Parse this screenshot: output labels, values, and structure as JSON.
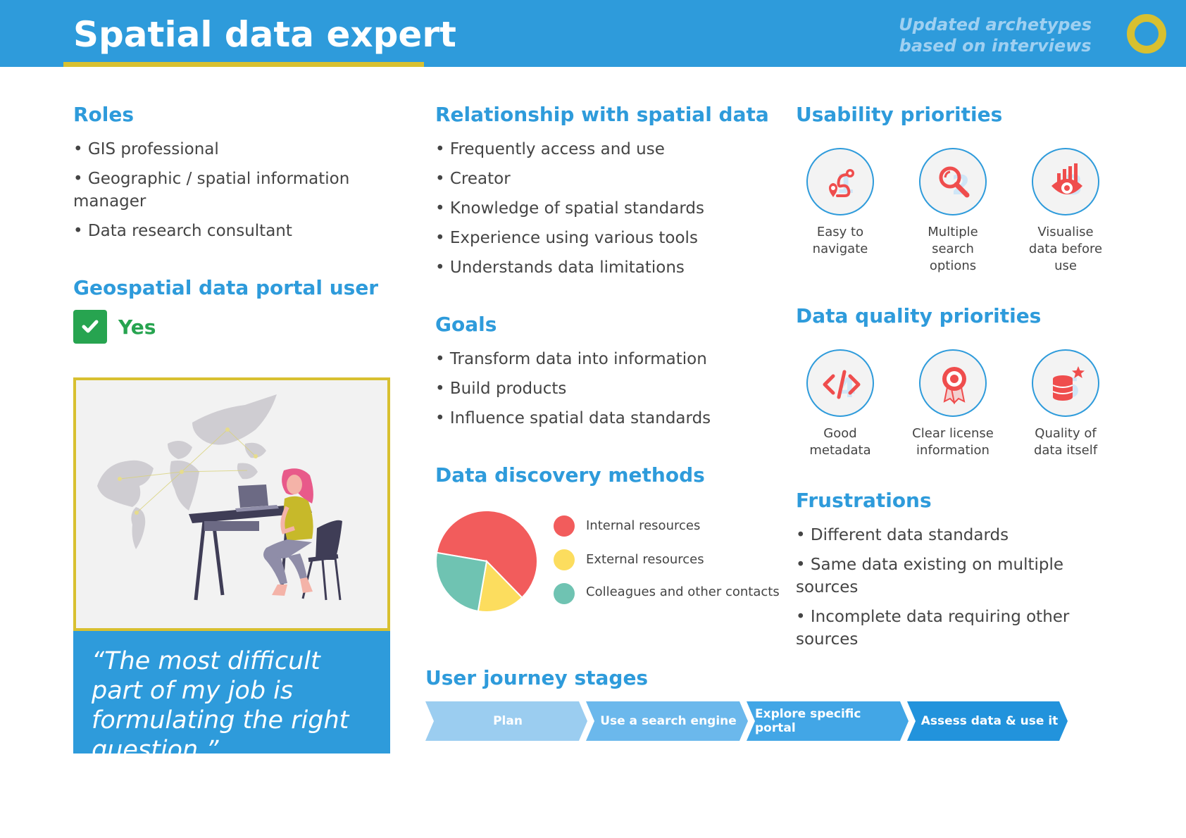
{
  "header": {
    "title": "Spatial data expert",
    "note_line1": "Updated archetypes",
    "note_line2": "based on interviews"
  },
  "roles": {
    "heading": "Roles",
    "items": [
      "GIS professional",
      "Geographic / spatial information manager",
      "Data research consultant"
    ]
  },
  "portal_user": {
    "heading": "Geospatial data portal user",
    "value": "Yes"
  },
  "quote": "“The most difficult part of my job is formulating the right question.”",
  "relationship": {
    "heading": "Relationship with spatial data",
    "items": [
      "Frequently access and use",
      "Creator",
      "Knowledge of spatial standards",
      "Experience using various tools",
      "Understands data limitations"
    ]
  },
  "goals": {
    "heading": "Goals",
    "items": [
      "Transform data into information",
      "Build products",
      "Influence spatial data standards"
    ]
  },
  "discovery": {
    "heading": "Data discovery methods"
  },
  "chart_data": {
    "type": "pie",
    "categories": [
      "Internal resources",
      "External resources",
      "Colleagues and other contacts"
    ],
    "values": [
      60,
      15,
      25
    ],
    "colors": [
      "#f25c5c",
      "#fcdd5e",
      "#6fc3b2"
    ],
    "legend_position": "right"
  },
  "usability": {
    "heading": "Usability priorities",
    "items": [
      {
        "line1": "Easy to",
        "line2": "navigate",
        "line3": "",
        "icon": "route-icon"
      },
      {
        "line1": "Multiple",
        "line2": "search",
        "line3": "options",
        "icon": "magnifier-icon"
      },
      {
        "line1": "Visualise",
        "line2": "data before",
        "line3": "use",
        "icon": "eye-chart-icon"
      }
    ]
  },
  "quality": {
    "heading": "Data quality priorities",
    "items": [
      {
        "line1": "Good",
        "line2": "metadata",
        "icon": "code-icon"
      },
      {
        "line1": "Clear license",
        "line2": "information",
        "icon": "award-icon"
      },
      {
        "line1": "Quality of",
        "line2": "data itself",
        "icon": "database-star-icon"
      }
    ]
  },
  "frustrations": {
    "heading": "Frustrations",
    "items": [
      "Different data standards",
      "Same data existing on multiple sources",
      "Incomplete data requiring other sources"
    ]
  },
  "journey": {
    "heading": "User journey stages",
    "stages": [
      "Plan",
      "Use a search engine",
      "Explore specific portal",
      "Assess data & use it"
    ],
    "colors": [
      "#9bcdf0",
      "#6bb8ec",
      "#42a6e6",
      "#2293dc"
    ]
  }
}
